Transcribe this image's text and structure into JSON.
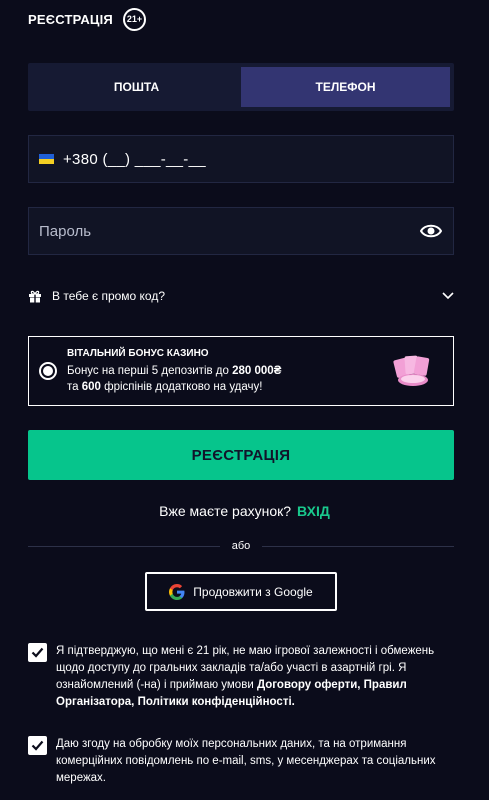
{
  "header": {
    "title": "РЕЄСТРАЦІЯ",
    "age_badge": "21+"
  },
  "tabs": [
    {
      "label": "ПОШТА",
      "active": false
    },
    {
      "label": "ТЕЛЕФОН",
      "active": true
    }
  ],
  "phone": {
    "flag": "ukraine-flag-icon",
    "value": "+380 (__) ___-__-__"
  },
  "password": {
    "placeholder": "Пароль",
    "icon": "eye-icon"
  },
  "promo": {
    "label": "В тебе є промо код?",
    "icon": "gift-icon",
    "expand_icon": "chevron-down-icon"
  },
  "bonus": {
    "title": "ВІТАЛЬНИЙ БОНУС КАЗИНО",
    "line1_prefix": "Бонус на перші 5 депозитів до ",
    "line1_amount": "280 000₴",
    "line2_prefix": "та ",
    "line2_amount": "600",
    "line2_suffix": " фріспінів додатково на удачу!",
    "selected": true
  },
  "register_button": "РЕЄСТРАЦІЯ",
  "login": {
    "question": "Вже маєте рахунок?",
    "link": "ВХІД"
  },
  "divider": {
    "label": "або"
  },
  "google_button": "Продовжити з Google",
  "consents": [
    {
      "checked": true,
      "text": "Я підтверджую, що мені є 21 рік, не маю ігрової залежності і обмежень щодо доступу до гральних закладів та/або участі в азартній грі. Я ознайомлений (-на) і приймаю умови ",
      "bold": "Договору оферти, Правил Організатора, Політики конфіденційності."
    },
    {
      "checked": true,
      "text": "Даю згоду на обробку моїх персональних даних, та на отримання комерційних повідомлень по e-mail, sms, у месенджерах та соціальних мережах."
    }
  ],
  "colors": {
    "background": "#0b0c1b",
    "accent": "#06c58c",
    "tab_active": "#333572",
    "link": "#19c98d"
  }
}
